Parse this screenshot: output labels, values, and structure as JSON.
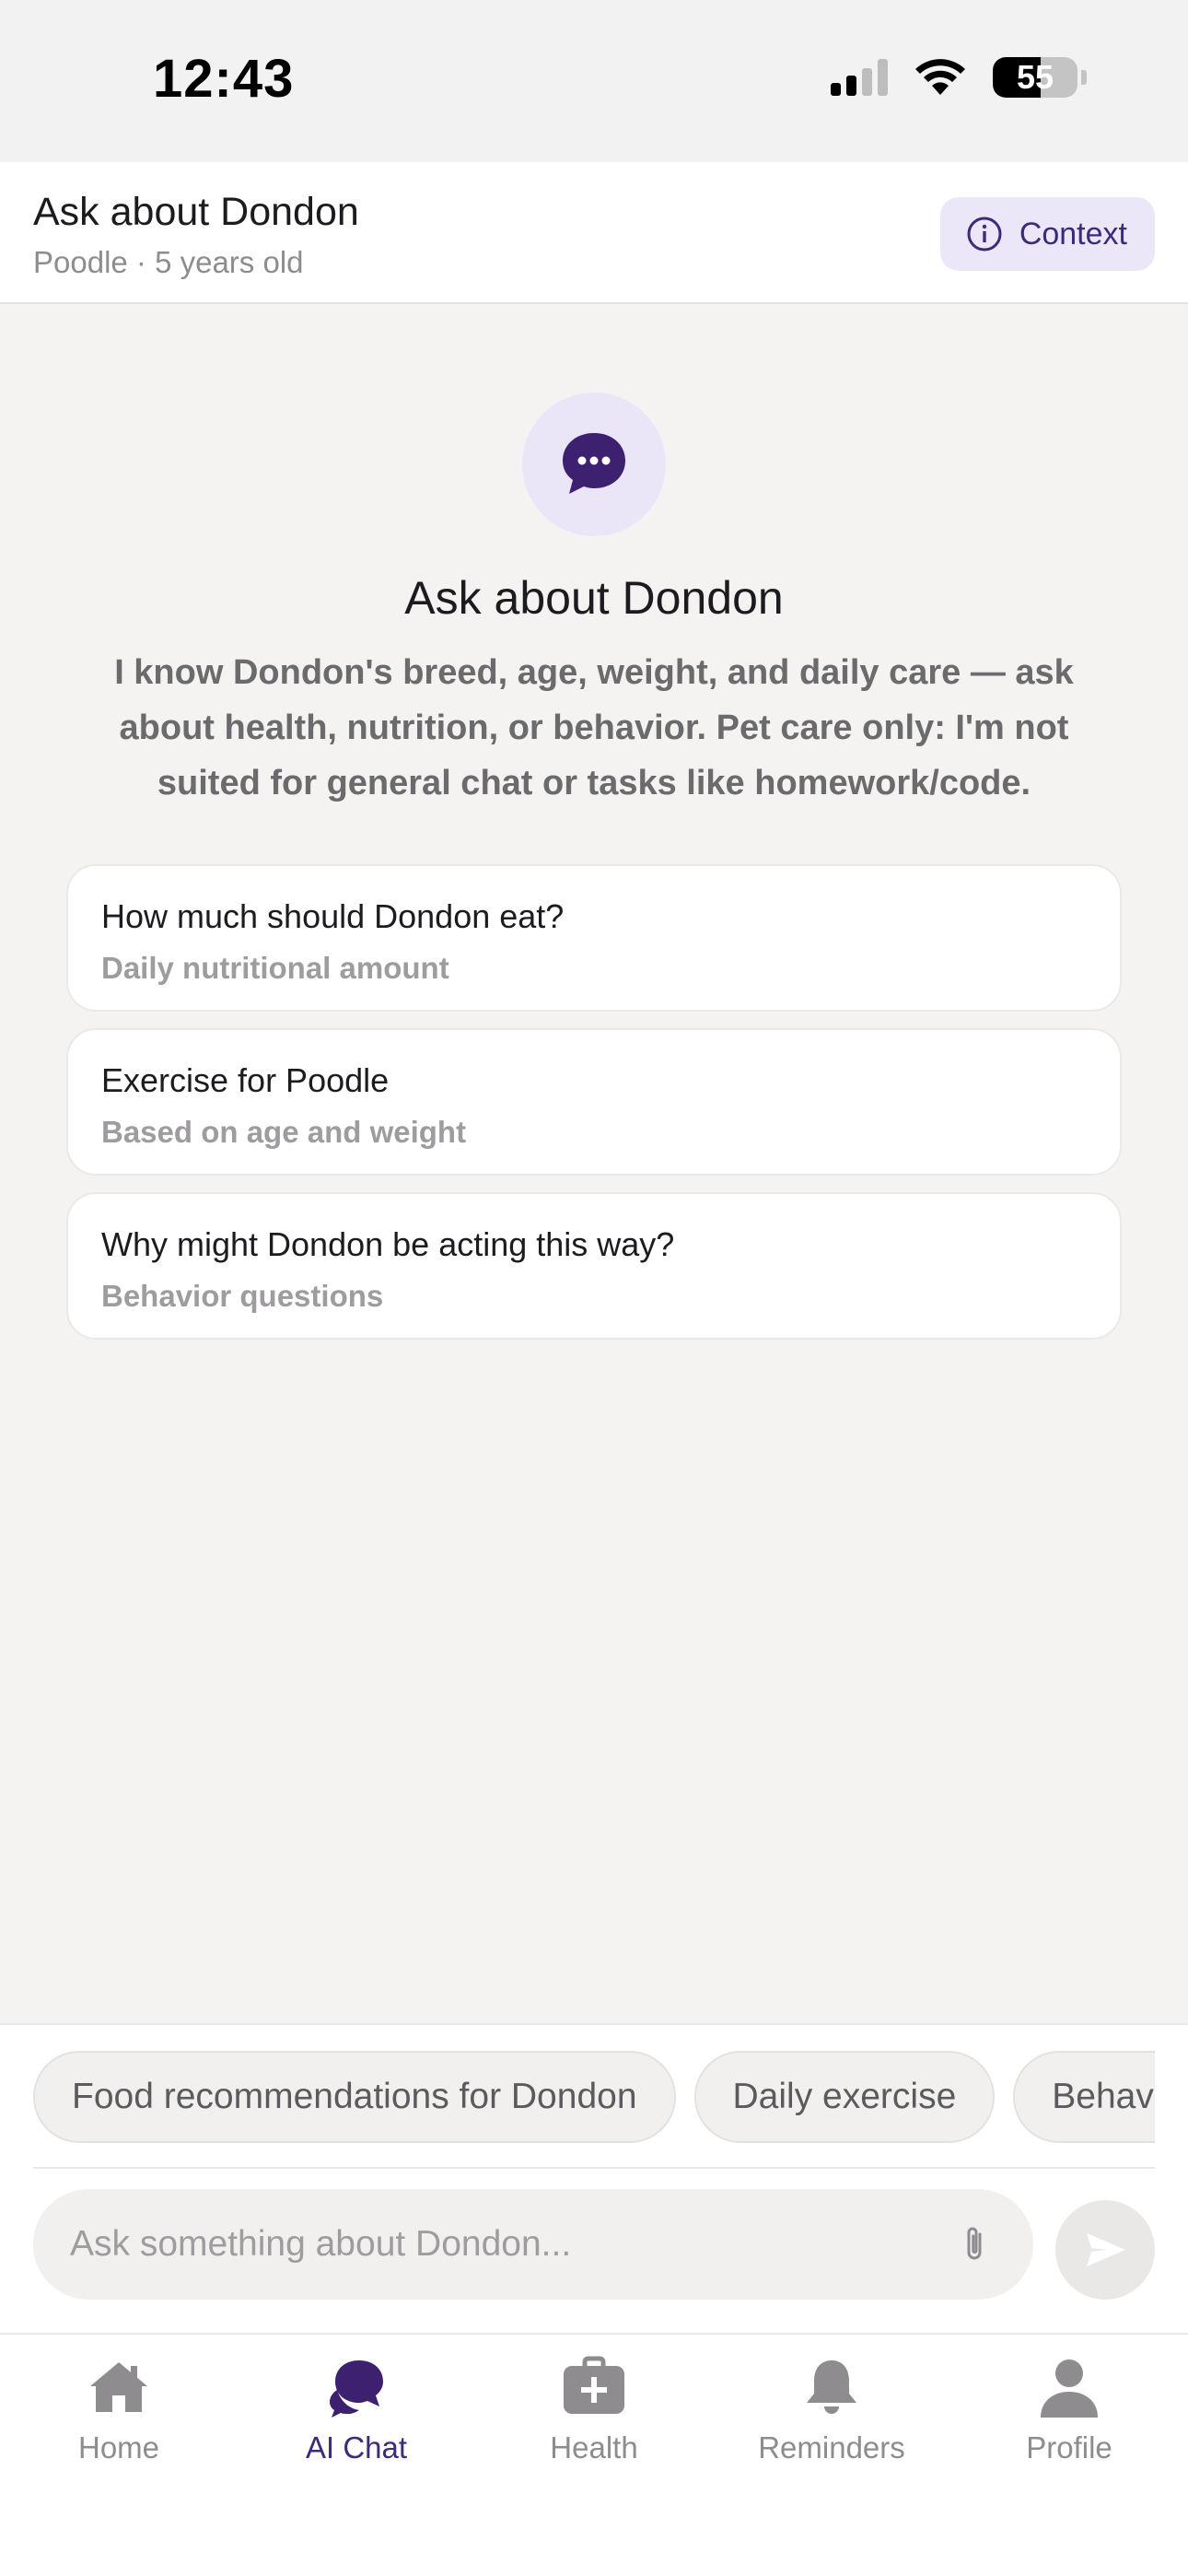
{
  "status_bar": {
    "time": "12:43",
    "battery": "55"
  },
  "header": {
    "title": "Ask about Dondon",
    "subtitle": "Poodle · 5 years old",
    "context_label": "Context"
  },
  "hero": {
    "title": "Ask about Dondon",
    "description": "I know Dondon's breed, age, weight, and daily care — ask about health, nutrition, or behavior. Pet care only: I'm not suited for general chat or tasks like homework/code."
  },
  "suggestions": [
    {
      "title": "How much should Dondon eat?",
      "subtitle": "Daily nutritional amount"
    },
    {
      "title": "Exercise for Poodle",
      "subtitle": "Based on age and weight"
    },
    {
      "title": "Why might Dondon be acting this way?",
      "subtitle": "Behavior questions"
    }
  ],
  "quick_chips": [
    "Food recommendations for Dondon",
    "Daily exercise",
    "Behavior"
  ],
  "input": {
    "placeholder": "Ask something about Dondon..."
  },
  "tabs": [
    {
      "label": "Home",
      "icon": "home-icon"
    },
    {
      "label": "AI Chat",
      "icon": "chat-icon",
      "active": true
    },
    {
      "label": "Health",
      "icon": "health-icon"
    },
    {
      "label": "Reminders",
      "icon": "bell-icon"
    },
    {
      "label": "Profile",
      "icon": "person-icon"
    }
  ],
  "colors": {
    "accent": "#3d2a7a",
    "accent_soft": "#ece7f8",
    "inactive": "#8e8c8e"
  }
}
